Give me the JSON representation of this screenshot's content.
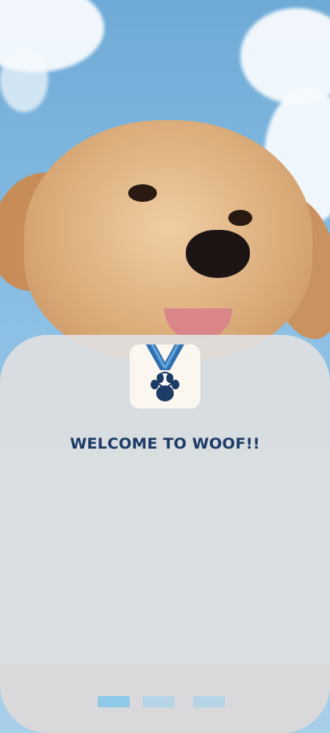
{
  "welcome": {
    "title": "WELCOME TO WOOF!!"
  },
  "logo": {
    "icon": "paw-medal-icon"
  },
  "pager": {
    "count": 3,
    "active_index": 0,
    "colors": {
      "active": "#8ec9e8",
      "inactive": "#b5d5e6"
    }
  },
  "colors": {
    "title": "#1c3c66",
    "medal_ribbon": "#2f6fb0",
    "paw": "#1c3c66"
  }
}
